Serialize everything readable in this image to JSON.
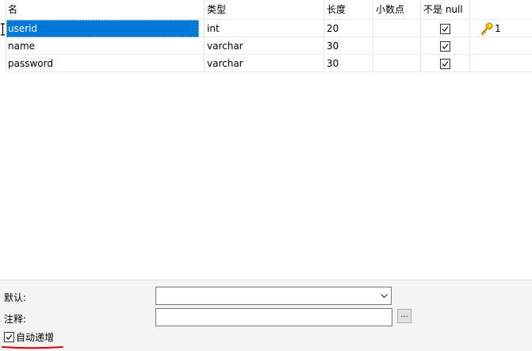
{
  "columns": {
    "name": "名",
    "type": "类型",
    "length": "长度",
    "decimals": "小数点",
    "not_null": "不是 null"
  },
  "rows": [
    {
      "name": "userid",
      "type": "int",
      "length": "20",
      "decimals": "",
      "not_null": true,
      "key": "1",
      "selected": true
    },
    {
      "name": "name",
      "type": "varchar",
      "length": "30",
      "decimals": "",
      "not_null": true,
      "key": ""
    },
    {
      "name": "password",
      "type": "varchar",
      "length": "30",
      "decimals": "",
      "not_null": true,
      "key": ""
    }
  ],
  "icons": {
    "row_marker": "text-cursor-icon",
    "primary_key": "key-icon",
    "checkbox": "checkmark-icon",
    "combo_arrow": "chevron-down-icon"
  },
  "colors": {
    "selection": "#0078d7",
    "key": "#e8b400",
    "underline": "#e00000"
  },
  "properties": {
    "default_label": "默认:",
    "default_value": "",
    "comment_label": "注释:",
    "comment_value": "",
    "ellipsis_label": "...",
    "auto_increment_label": "自动递增",
    "auto_increment_checked": true
  }
}
